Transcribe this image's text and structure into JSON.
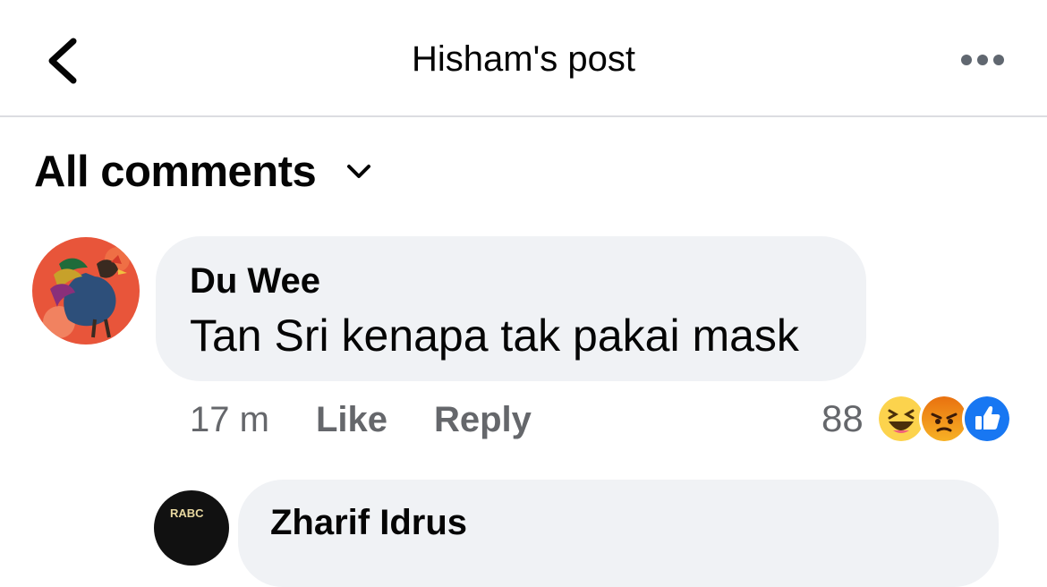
{
  "header": {
    "title": "Hisham's post",
    "back_icon": "chevron-left-icon",
    "more_icon": "more-horizontal-icon"
  },
  "filter": {
    "label": "All comments",
    "icon": "chevron-down-icon"
  },
  "comments": [
    {
      "author": "Du Wee",
      "text": "Tan Sri kenapa tak pakai mask",
      "time": "17 m",
      "like_label": "Like",
      "reply_label": "Reply",
      "reaction_count": "88",
      "reactions": [
        "haha-icon",
        "angry-icon",
        "like-icon"
      ]
    }
  ],
  "reply_preview": {
    "author": "Zharif Idrus",
    "avatar_text": "RABC"
  },
  "colors": {
    "bubble": "#f0f2f5",
    "secondary_text": "#65676b",
    "like_blue": "#1877f2",
    "haha_yellow": "#fcd34d",
    "angry_orange": "#e9710f"
  }
}
